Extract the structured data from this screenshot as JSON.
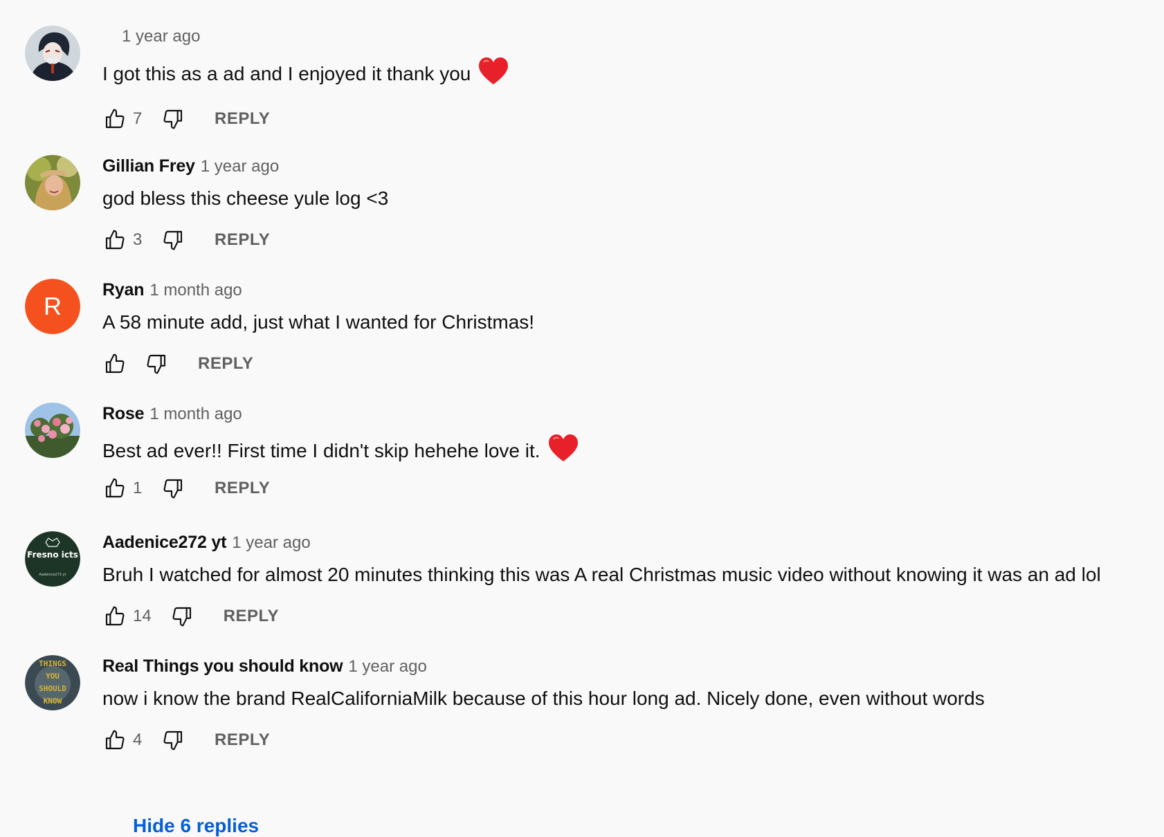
{
  "comments": [
    {
      "author": "",
      "time": "1 year ago",
      "text": "I got this as a ad and I enjoyed it thank you",
      "heart": true,
      "likes": "7",
      "reply_label": "REPLY",
      "avatar_icon": "anime-character-avatar"
    },
    {
      "author": "Gillian Frey",
      "time": "1 year ago",
      "text": "god bless this cheese yule log <3",
      "heart": false,
      "likes": "3",
      "reply_label": "REPLY",
      "avatar_icon": "person-photo-avatar"
    },
    {
      "author": "Ryan",
      "time": "1 month ago",
      "text": "A 58 minute add, just what I wanted for Christmas!",
      "heart": false,
      "likes": "",
      "reply_label": "REPLY",
      "avatar_letter": "R",
      "avatar_color": "#f4511e"
    },
    {
      "author": "Rose",
      "time": "1 month ago",
      "text": "Best ad ever!! First time I didn't skip hehehe love it.",
      "heart": true,
      "likes": "1",
      "reply_label": "REPLY",
      "avatar_icon": "flowers-photo-avatar"
    },
    {
      "author": "Aadenice272 yt",
      "time": "1 year ago",
      "text": "Bruh I watched for almost 20 minutes thinking this was A real Christmas music video without knowing it was an ad lol",
      "heart": false,
      "likes": "14",
      "reply_label": "REPLY",
      "avatar_text": "Fresno icts",
      "avatar_subtext": "Aadenice272 yt"
    },
    {
      "author": "Real Things you should know",
      "time": "1 year ago",
      "text": "now i know the brand RealCaliforniaMilk because of this hour long ad. Nicely done, even without words",
      "heart": false,
      "likes": "4",
      "reply_label": "REPLY",
      "avatar_lines": [
        "THINGS",
        "YOU",
        "SHOULD",
        "KNOW"
      ]
    }
  ],
  "hide_replies_label": "Hide 6 replies",
  "colors": {
    "heart": "#e8202a",
    "reply": "#606060",
    "link": "#065fd4",
    "ryan_avatar": "#f4511e"
  }
}
